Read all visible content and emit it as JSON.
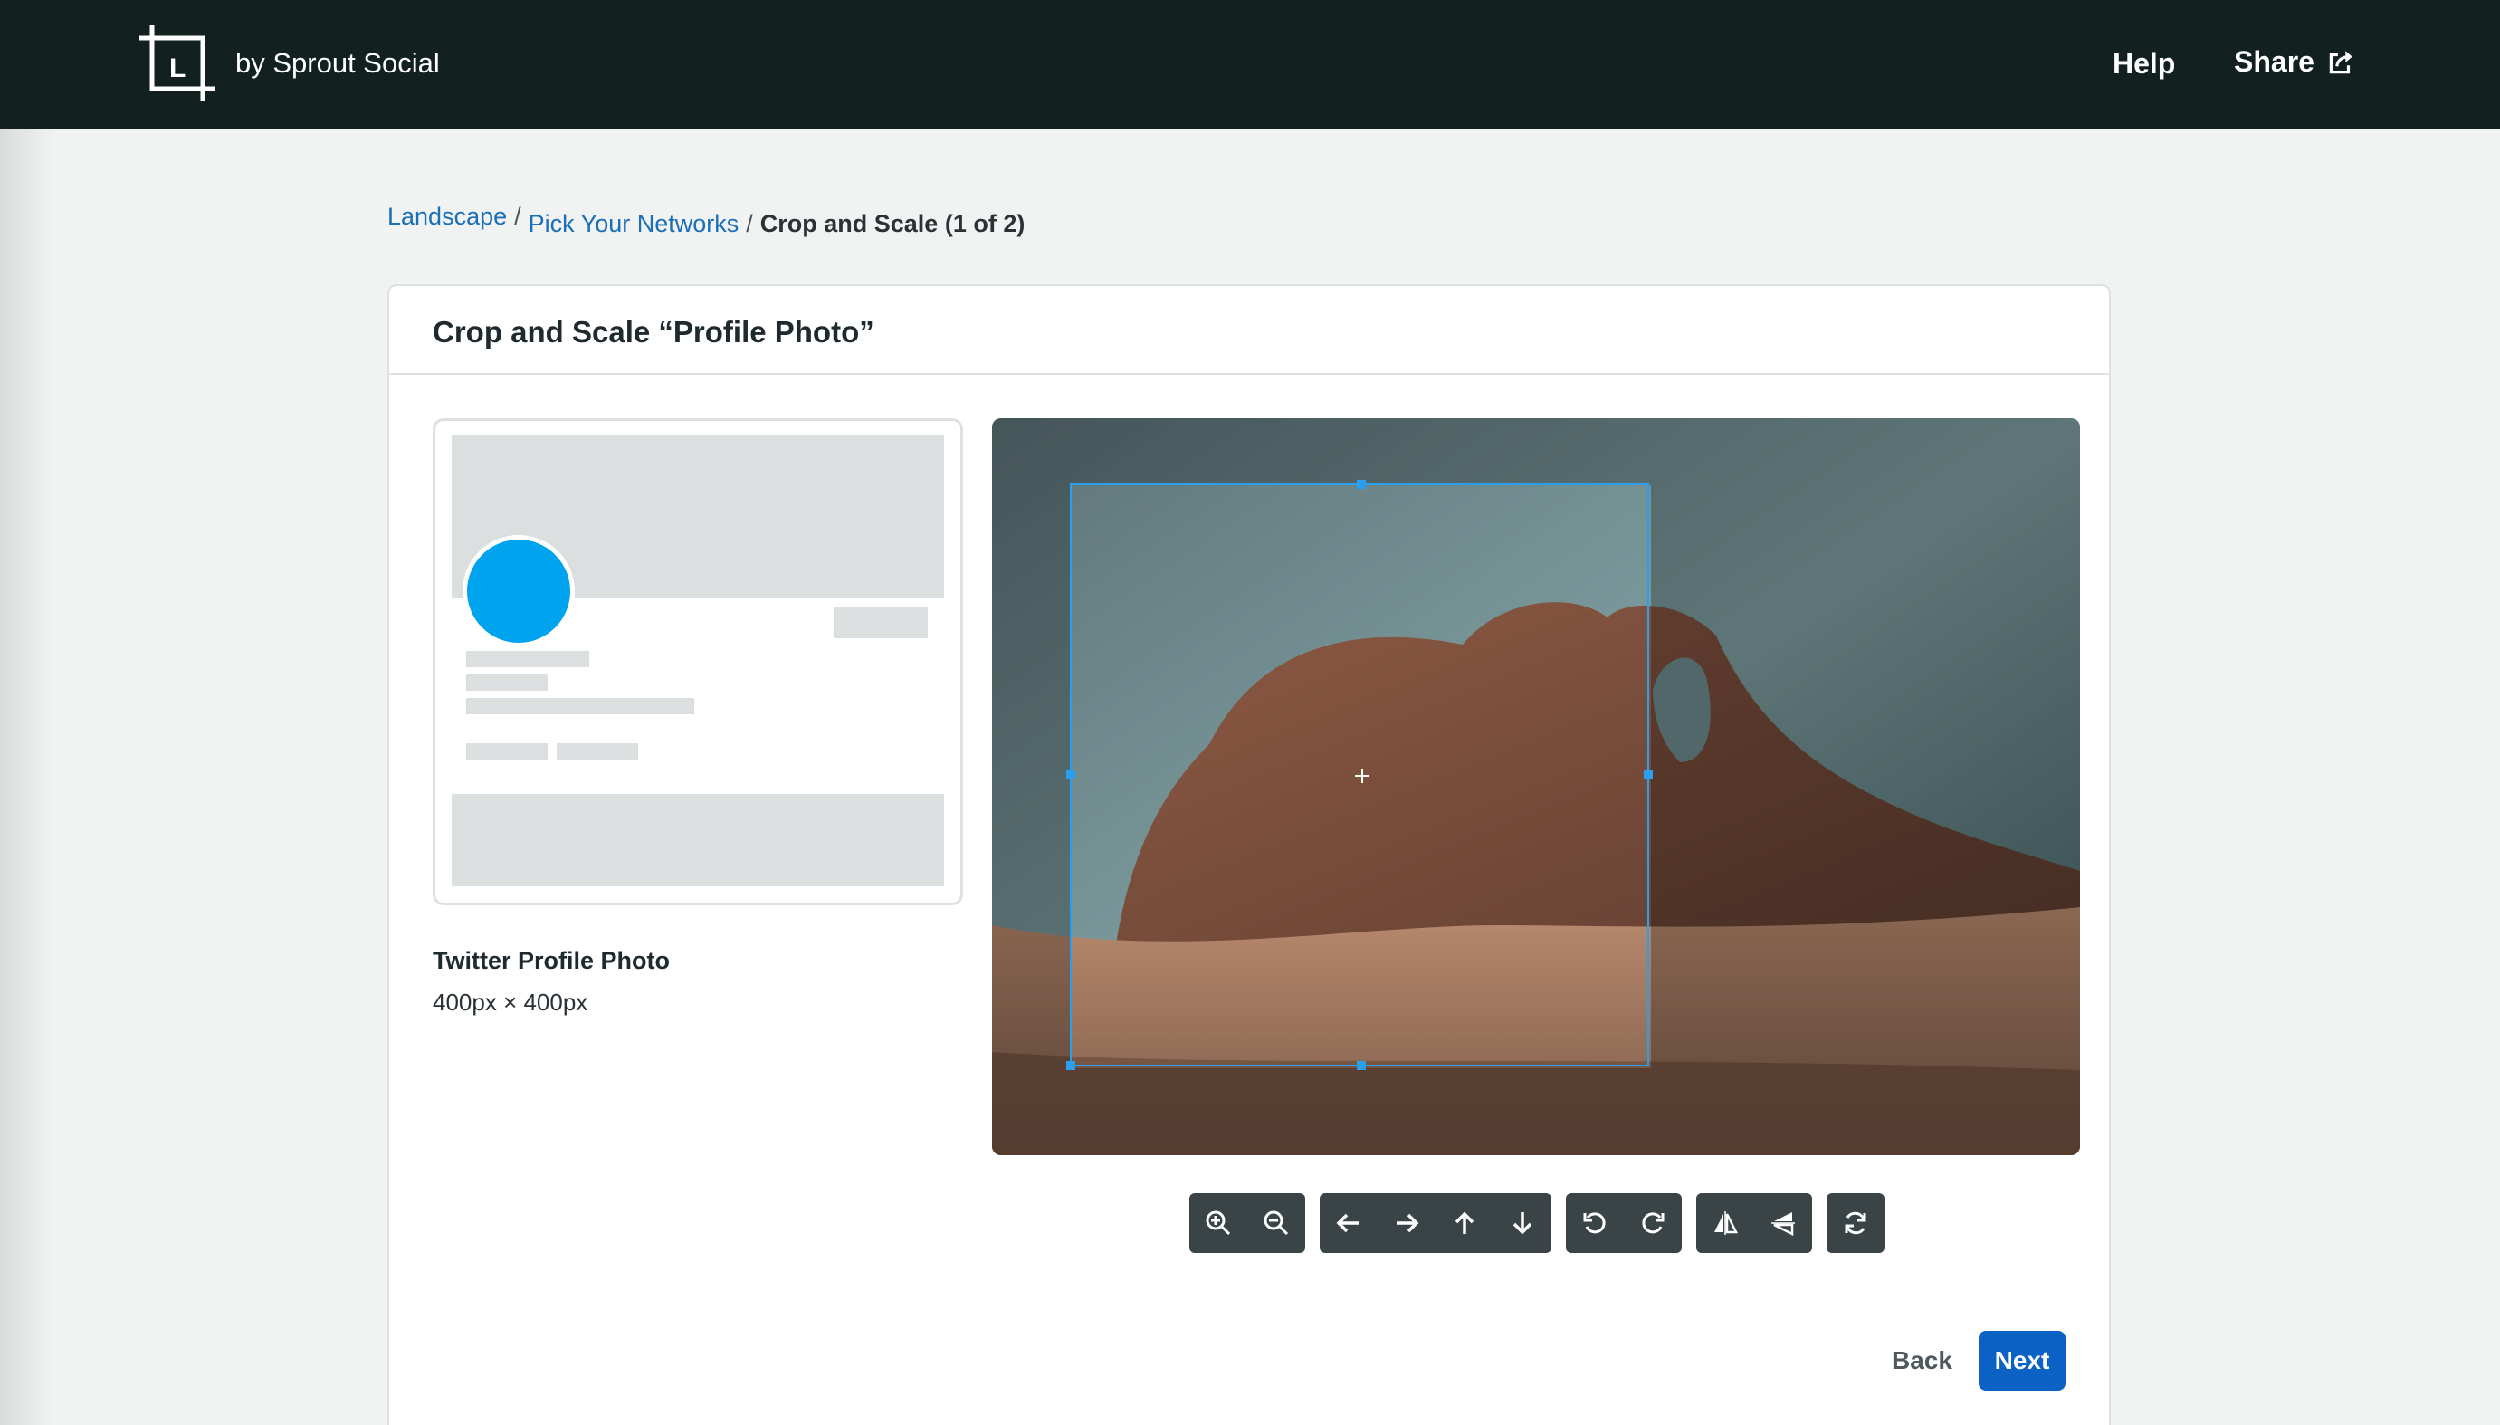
{
  "header": {
    "brand": "by Sprout Social",
    "logo_icon": "crop-l-logo-icon",
    "help_label": "Help",
    "share_label": "Share",
    "share_icon": "share-external-icon",
    "background_color": "#12201f"
  },
  "breadcrumb": {
    "items": [
      {
        "label": "Landscape",
        "link": true
      },
      {
        "label": "Pick Your Networks",
        "link": true
      },
      {
        "label": "Crop and Scale (1 of 2)",
        "link": false
      }
    ],
    "separator": "/",
    "link_color": "#1a6fb8"
  },
  "card": {
    "title": "Crop and Scale “Profile Photo”"
  },
  "preview": {
    "name": "Twitter Profile Photo",
    "size": "400px × 400px",
    "avatar_color": "#00a3ee"
  },
  "toolbar": {
    "groups": [
      [
        "zoom-in-icon",
        "zoom-out-icon"
      ],
      [
        "arrow-left-icon",
        "arrow-right-icon",
        "arrow-up-icon",
        "arrow-down-icon"
      ],
      [
        "rotate-left-icon",
        "rotate-right-icon"
      ],
      [
        "flip-horizontal-icon",
        "flip-vertical-icon"
      ],
      [
        "reset-icon"
      ]
    ]
  },
  "actions": {
    "back_label": "Back",
    "next_label": "Next",
    "accent_color": "#0b62c4"
  }
}
